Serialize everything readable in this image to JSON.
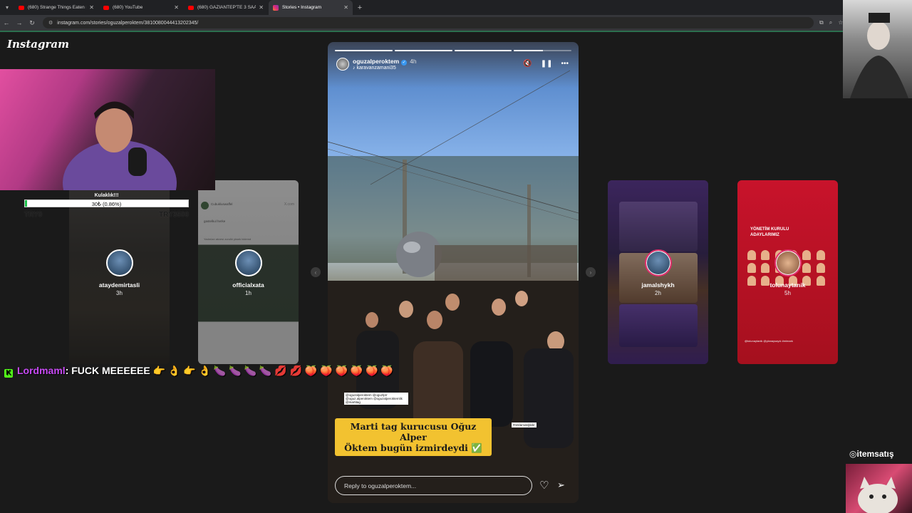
{
  "browser": {
    "tabs": [
      {
        "title": "(680) Strange Things Eaten in B",
        "icon": "youtube-icon",
        "active": false
      },
      {
        "title": "(680) YouTube",
        "icon": "youtube-icon",
        "active": false
      },
      {
        "title": "(680) GAZİANTEP'TE 3 SAATTE",
        "icon": "youtube-icon",
        "active": false
      },
      {
        "title": "Stories • Instagram",
        "icon": "instagram-icon",
        "active": true
      }
    ],
    "url": "instagram.com/stories/oguzalperoktem/3810080044413202345/"
  },
  "instagram": {
    "logo": "Instagram",
    "story": {
      "progress": [
        1,
        1,
        1,
        0.5
      ],
      "username": "oguzalperoktem",
      "time": "4h",
      "music_user": "karavanzamani35",
      "tag_text": "@oguzalperoktem @oguzlprr @oguz.alperoktem @oguzalperoktemlik @martitag",
      "ad_tag": "#reklamdeğildir",
      "caption_line1": "Marti tag kurucusu Oğuz Alper",
      "caption_line2": "Öktem bugün izmirdeydi ✅",
      "reply_placeholder": "Reply to oguzalperoktem..."
    },
    "previews": [
      {
        "username": "ataydemirtasli",
        "time": "3h"
      },
      {
        "username": "officialxata",
        "time": "1h",
        "top_text": "Cubukluswaffel",
        "top_url": "X.com",
        "top_line": "gastelkul herke",
        "top_line2": "Yadırılan akvesi zorulki yksek tıklemd"
      },
      {
        "username": "jamalshykh",
        "time": "2h"
      },
      {
        "username": "tolunaytanik",
        "time": "5h",
        "heading": "YÖNETİM KURULU ADAYLARIMIZ",
        "footer": "@tolunaytanik @ylanaysayık #mimark"
      }
    ]
  },
  "overlay": {
    "goal_title": "Kulaklık!!!",
    "goal_text": "30₺ (0.86%)",
    "goal_progress": 0.0086,
    "goal_min": "TRY0",
    "goal_max": "TRY3500",
    "chat_user": "Lordmaml",
    "chat_message": ": FUCK MEEEEEE 👉 👌 👉 👌 🍆 🍆 🍆 🍆 💋 💋 🍑 🍑 🍑 🍑 🍑 🍑",
    "brand": "itemsatış"
  }
}
